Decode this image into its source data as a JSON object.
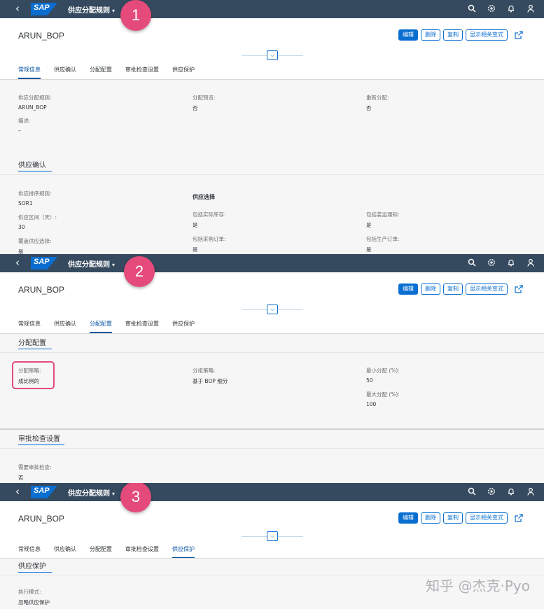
{
  "shell": {
    "back": "‹",
    "logo": "SAP",
    "app_title": "供应分配规则",
    "caret": "▾"
  },
  "header": {
    "object_title": "ARUN_BOP",
    "buttons": {
      "edit": "编辑",
      "delete": "删除",
      "copy": "复制",
      "show_related": "显示相关变式"
    }
  },
  "tabs": [
    "常规信息",
    "供应确认",
    "分配配置",
    "审批检查设置",
    "供应保护"
  ],
  "badges": [
    "1",
    "2",
    "3"
  ],
  "panel1": {
    "active_tab": 0,
    "general": {
      "rule_label": "供应分配规则:",
      "rule_value": "ARUN_BOP",
      "preview_label": "分配预览:",
      "preview_value": "否",
      "realloc_label": "重新分配:",
      "realloc_value": "否",
      "desc_label": "描述:",
      "desc_value": "–"
    },
    "confirm_section_title": "供应确认",
    "confirm": {
      "sort_label": "供应排序规则:",
      "sort_value": "SOR1",
      "horizon_label": "供应区间（天）:",
      "horizon_value": "30",
      "override_label": "覆盖供应选择:",
      "override_value": "是",
      "selection_title": "供应选择",
      "stock_label": "包括实际库存:",
      "stock_value": "是",
      "po_label": "包括采购订单:",
      "po_value": "是",
      "ship_label": "包括装运通知:",
      "ship_value": "是",
      "prod_label": "包括生产订单:",
      "prod_value": "是"
    }
  },
  "panel2": {
    "active_tab": 2,
    "section_title": "分配配置",
    "strategy_label": "分配策略:",
    "strategy_value": "成比例的",
    "group_label": "分组策略:",
    "group_value": "基于 BOP 细分",
    "min_label": "最小分配 (%):",
    "min_value": "50",
    "max_label": "最大分配 (%):",
    "max_value": "100",
    "approval_title": "审批检查设置",
    "approval_label": "需要审批检查:",
    "approval_value": "否"
  },
  "panel3": {
    "active_tab": 4,
    "section_title": "供应保护",
    "mode_label": "执行模式:",
    "mode_value": "忽略供应保护"
  },
  "watermark": "知乎 @杰克·Pyo",
  "colors": {
    "shell": "#354a5f",
    "accent": "#0a6ed1",
    "badge": "#e44b7a"
  }
}
